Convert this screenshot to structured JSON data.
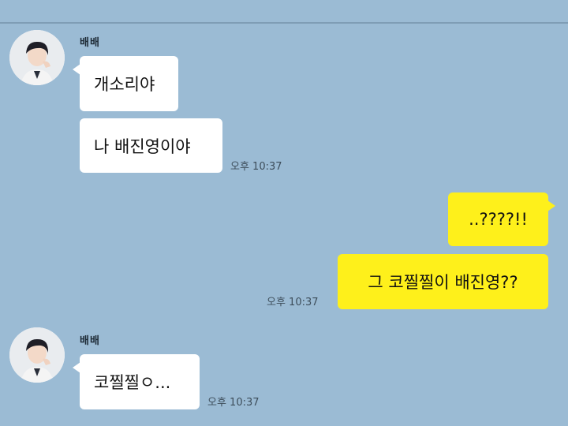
{
  "colors": {
    "background": "#9bbbd4",
    "incoming_bubble": "#ffffff",
    "outgoing_bubble": "#fef01b"
  },
  "messages": {
    "group1": {
      "sender": "배배",
      "bubble1": "개소리야",
      "bubble2": "나 배진영이야",
      "time": "오후 10:37"
    },
    "group2": {
      "bubble1": "..????!!",
      "bubble2": "그 코찔찔이 배진영??",
      "time": "오후 10:37"
    },
    "group3": {
      "sender": "배배",
      "bubble1": "코찔찔ㅇ...",
      "time": "오후 10:37"
    }
  }
}
